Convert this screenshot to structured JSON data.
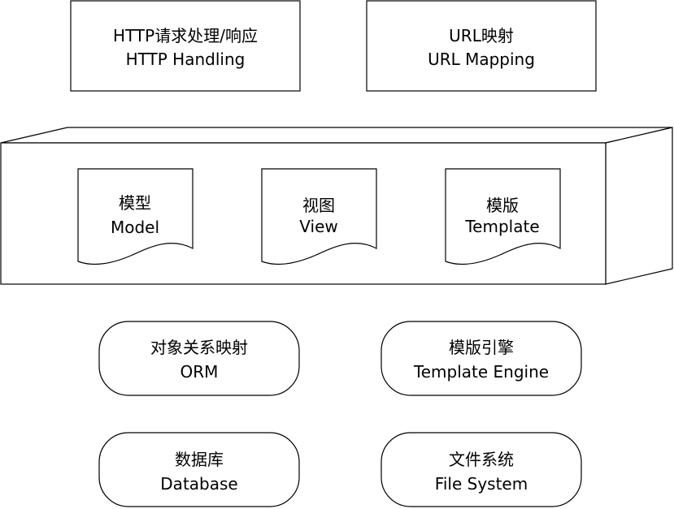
{
  "boxes": {
    "http": {
      "line1": "HTTP请求处理/响应",
      "line2": "HTTP Handling"
    },
    "url": {
      "line1": "URL映射",
      "line2": "URL Mapping"
    }
  },
  "mvt": {
    "model": {
      "line1": "模型",
      "line2": "Model"
    },
    "view": {
      "line1": "视图",
      "line2": "View"
    },
    "template": {
      "line1": "模版",
      "line2": "Template"
    }
  },
  "services": {
    "orm": {
      "line1": "对象关系映射",
      "line2": "ORM"
    },
    "engine": {
      "line1": "模版引擎",
      "line2": "Template Engine"
    },
    "database": {
      "line1": "数据库",
      "line2": "Database"
    },
    "filesystem": {
      "line1": "文件系统",
      "line2": "File System"
    }
  }
}
